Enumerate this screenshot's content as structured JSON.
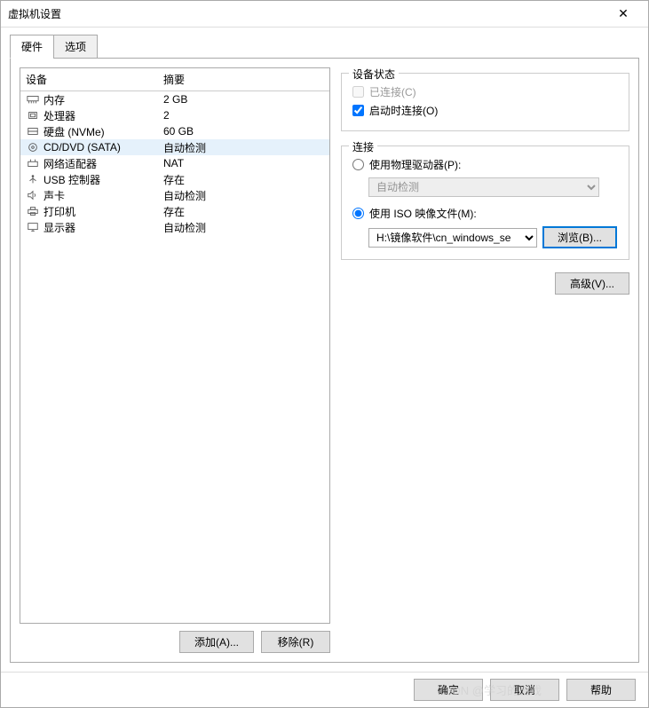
{
  "window": {
    "title": "虚拟机设置"
  },
  "tabs": {
    "hardware": "硬件",
    "options": "选项"
  },
  "headers": {
    "device": "设备",
    "summary": "摘要"
  },
  "devices": [
    {
      "name": "内存",
      "summary": "2 GB",
      "icon": "memory"
    },
    {
      "name": "处理器",
      "summary": "2",
      "icon": "cpu"
    },
    {
      "name": "硬盘 (NVMe)",
      "summary": "60 GB",
      "icon": "disk"
    },
    {
      "name": "CD/DVD (SATA)",
      "summary": "自动检测",
      "icon": "cd",
      "selected": true
    },
    {
      "name": "网络适配器",
      "summary": "NAT",
      "icon": "network"
    },
    {
      "name": "USB 控制器",
      "summary": "存在",
      "icon": "usb"
    },
    {
      "name": "声卡",
      "summary": "自动检测",
      "icon": "sound"
    },
    {
      "name": "打印机",
      "summary": "存在",
      "icon": "printer"
    },
    {
      "name": "显示器",
      "summary": "自动检测",
      "icon": "display"
    }
  ],
  "buttons": {
    "add": "添加(A)...",
    "remove": "移除(R)",
    "browse": "浏览(B)...",
    "advanced": "高级(V)...",
    "ok": "确定",
    "cancel": "取消",
    "help": "帮助"
  },
  "status": {
    "legend": "设备状态",
    "connected": "已连接(C)",
    "connectAtPowerOn": "启动时连接(O)"
  },
  "connection": {
    "legend": "连接",
    "usePhysical": "使用物理驱动器(P):",
    "autoDetect": "自动检测",
    "useIso": "使用 ISO 映像文件(M):",
    "isoPath": "H:\\镜像软件\\cn_windows_se"
  },
  "watermark": "CSDN @学习的游戏"
}
